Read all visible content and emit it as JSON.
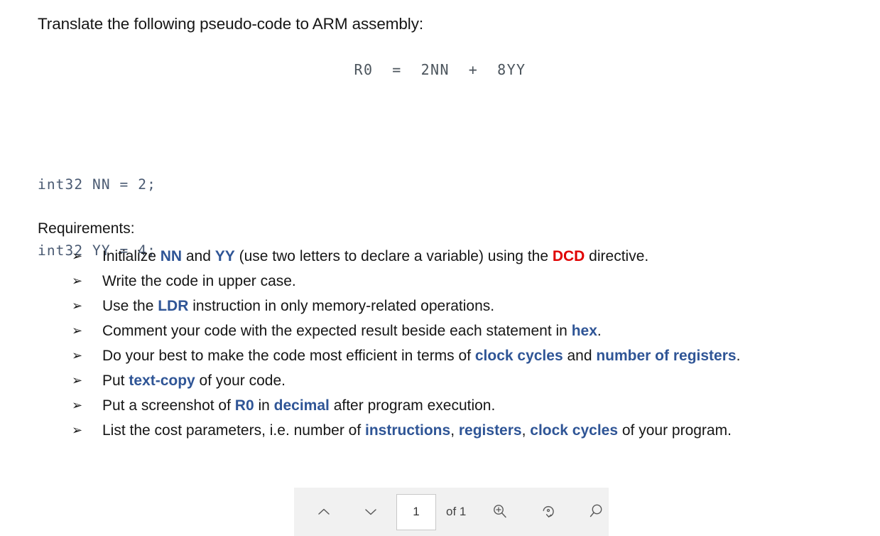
{
  "document": {
    "prompt": "Translate the following pseudo-code to ARM assembly:",
    "equation": "R0  =  2NN  +  8YY",
    "code_lines": [
      "int32 NN = 2;",
      "int32 YY = 4;"
    ],
    "requirements_heading": "Requirements:",
    "bullet_glyph": "➢",
    "requirements": [
      {
        "parts": [
          {
            "text": "Initialize ",
            "style": "plain"
          },
          {
            "text": "NN",
            "style": "blue"
          },
          {
            "text": " and ",
            "style": "plain"
          },
          {
            "text": "YY",
            "style": "blue"
          },
          {
            "text": " (use two letters to declare a variable) using the ",
            "style": "plain"
          },
          {
            "text": "DCD",
            "style": "red"
          },
          {
            "text": " directive.",
            "style": "plain"
          }
        ]
      },
      {
        "parts": [
          {
            "text": "Write the code in upper case.",
            "style": "plain"
          }
        ]
      },
      {
        "parts": [
          {
            "text": "Use the ",
            "style": "plain"
          },
          {
            "text": "LDR",
            "style": "blue"
          },
          {
            "text": " instruction in only memory-related operations.",
            "style": "plain"
          }
        ]
      },
      {
        "parts": [
          {
            "text": "Comment your code with the expected result beside each statement in ",
            "style": "plain"
          },
          {
            "text": "hex",
            "style": "blue"
          },
          {
            "text": ".",
            "style": "plain"
          }
        ]
      },
      {
        "parts": [
          {
            "text": "Do your best to make the code most efficient in terms of ",
            "style": "plain"
          },
          {
            "text": "clock cycles",
            "style": "blue"
          },
          {
            "text": " and ",
            "style": "plain"
          },
          {
            "text": "number of registers",
            "style": "blue"
          },
          {
            "text": ".",
            "style": "plain"
          }
        ]
      },
      {
        "parts": [
          {
            "text": "Put ",
            "style": "plain"
          },
          {
            "text": "text-copy",
            "style": "blue"
          },
          {
            "text": " of your code.",
            "style": "plain"
          }
        ]
      },
      {
        "parts": [
          {
            "text": "Put a screenshot of ",
            "style": "plain"
          },
          {
            "text": "R0",
            "style": "blue"
          },
          {
            "text": " in ",
            "style": "plain"
          },
          {
            "text": "decimal",
            "style": "blue"
          },
          {
            "text": " after program execution.",
            "style": "plain"
          }
        ]
      },
      {
        "parts": [
          {
            "text": "List the cost parameters, i.e. number of ",
            "style": "plain"
          },
          {
            "text": "instructions",
            "style": "blue"
          },
          {
            "text": ", ",
            "style": "plain"
          },
          {
            "text": "registers",
            "style": "blue"
          },
          {
            "text": ", ",
            "style": "plain"
          },
          {
            "text": "clock cycles",
            "style": "blue"
          },
          {
            "text": " of your program.",
            "style": "plain"
          }
        ]
      }
    ]
  },
  "toolbar": {
    "previous_page_icon": "chevron-up-icon",
    "next_page_icon": "chevron-down-icon",
    "page_number_value": "1",
    "page_total_label": "of 1",
    "zoom_in_icon": "zoom-in-icon",
    "rotate_icon": "rotate-clockwise-icon",
    "search_icon": "search-icon"
  },
  "colors": {
    "keyword_blue": "#2f5596",
    "keyword_red": "#e00000",
    "code_blue": "#4a5a72",
    "equation_gray": "#4c555d",
    "toolbar_background": "#f1f1f1",
    "page_background": "#ffffff"
  }
}
